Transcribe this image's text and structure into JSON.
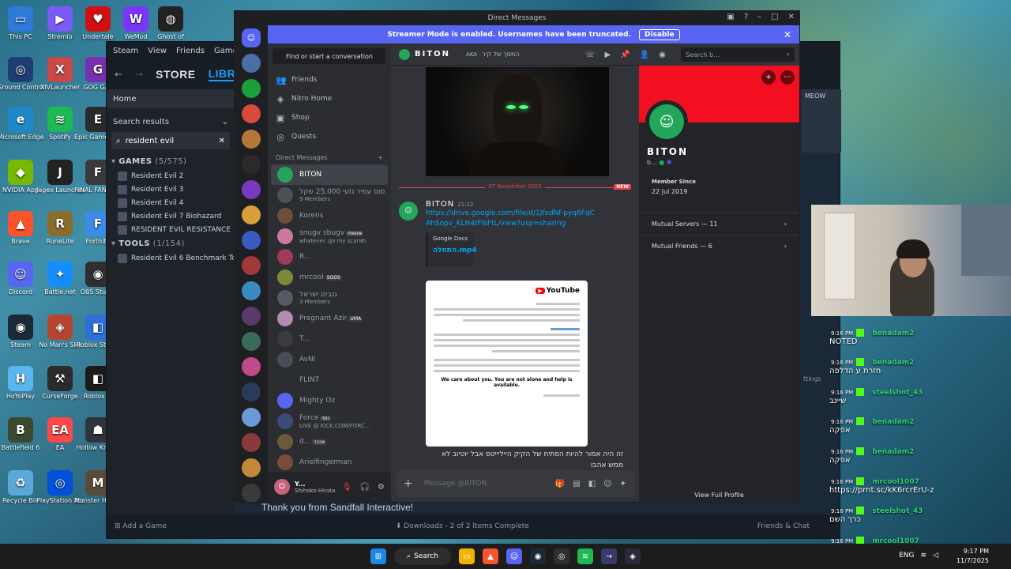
{
  "desktop": {
    "icons_col1": [
      {
        "label": "This PC",
        "color": "#2f7ad8",
        "glyph": "▭"
      },
      {
        "label": "Ground Control",
        "color": "#1e3d72",
        "glyph": "◎"
      },
      {
        "label": "Microsoft Edge",
        "color": "#1e88c8",
        "glyph": "e"
      },
      {
        "label": "NVIDIA App",
        "color": "#76b900",
        "glyph": "◆"
      },
      {
        "label": "Brave",
        "color": "#fb542b",
        "glyph": "▲"
      },
      {
        "label": "Discord",
        "color": "#5865f2",
        "glyph": "☺"
      },
      {
        "label": "Steam",
        "color": "#1b2838",
        "glyph": "◉"
      },
      {
        "label": "HoYoPlay",
        "color": "#5bb5f0",
        "glyph": "H"
      },
      {
        "label": "Battlefield 6",
        "color": "#3b4a2e",
        "glyph": "B"
      },
      {
        "label": "Recycle Bin",
        "color": "#5ca8d8",
        "glyph": "♻"
      }
    ],
    "icons_col2": [
      {
        "label": "Stremio",
        "color": "#7b5bf5",
        "glyph": "▶"
      },
      {
        "label": "XIVLauncher",
        "color": "#c94848",
        "glyph": "X"
      },
      {
        "label": "Spotify",
        "color": "#1db954",
        "glyph": "≋"
      },
      {
        "label": "Jagex Launcher",
        "color": "#222222",
        "glyph": "J"
      },
      {
        "label": "RuneLite",
        "color": "#8a6d2b",
        "glyph": "R"
      },
      {
        "label": "Battle.net",
        "color": "#148eff",
        "glyph": "✦"
      },
      {
        "label": "No Man's Sky",
        "color": "#b5452f",
        "glyph": "◈"
      },
      {
        "label": "CurseForge",
        "color": "#2b2b2b",
        "glyph": "⚒"
      },
      {
        "label": "EA",
        "color": "#ff4747",
        "glyph": "EA"
      },
      {
        "label": "PlayStation Accessories",
        "color": "#0050d8",
        "glyph": "◎"
      }
    ],
    "icons_col3": [
      {
        "label": "Undertale",
        "color": "#d01010",
        "glyph": "♥"
      },
      {
        "label": "GOG GAL",
        "color": "#7a2fb0",
        "glyph": "G"
      },
      {
        "label": "Epic Games Launcher",
        "color": "#2a2a2a",
        "glyph": "E"
      },
      {
        "label": "FINAL FANTASY",
        "color": "#3a3a3a",
        "glyph": "F"
      },
      {
        "label": "Fortnite",
        "color": "#3d8be8",
        "glyph": "F"
      },
      {
        "label": "OBS Studio",
        "color": "#302e31",
        "glyph": "◉"
      },
      {
        "label": "Roblox Studio",
        "color": "#2c6fd8",
        "glyph": "◧"
      },
      {
        "label": "Roblox Pl",
        "color": "#1b1b1b",
        "glyph": "◧"
      },
      {
        "label": "Hollow Knight",
        "color": "#30343a",
        "glyph": "☗"
      },
      {
        "label": "Monster Hunter W",
        "color": "#5a4a3a",
        "glyph": "M"
      }
    ],
    "icons_col4": [
      {
        "label": "WeMod",
        "color": "#7a35ff",
        "glyph": "W"
      },
      {
        "label": "Ghost of",
        "color": "#222222",
        "glyph": "◍"
      }
    ]
  },
  "steam": {
    "menu": [
      "Steam",
      "View",
      "Friends",
      "Games",
      "He"
    ],
    "nav_store": "STORE",
    "nav_library": "LIBRARY",
    "home": "Home",
    "search_results": "Search results",
    "search_value": "resident evil",
    "games_header": "GAMES",
    "games_count": "(5/575)",
    "games": [
      "Resident Evil 2",
      "Resident Evil 3",
      "Resident Evil 4",
      "Resident Evil 7 Biohazard",
      "RESIDENT EVIL RESISTANCE"
    ],
    "tools_header": "TOOLS",
    "tools_count": "(1/154)",
    "tools": [
      "Resident Evil 6 Benchmark Tool"
    ],
    "add_game": "Add a Game",
    "downloads": "Downloads - 2 of 2 Items Complete",
    "friends_chat": "Friends & Chat",
    "banner_text": "Thank you from Sandfall Interactive!",
    "meow": "MEOW",
    "settings_partial": "ttings"
  },
  "discord": {
    "window_title": "Direct Messages",
    "streamer_text": "Streamer Mode is enabled. Usernames have been truncated.",
    "streamer_btn": "Disable",
    "find_placeholder": "Find or start a conversation",
    "nav": [
      {
        "icon": "👥",
        "label": "Friends",
        "name": "friends"
      },
      {
        "icon": "◈",
        "label": "Nitro Home",
        "name": "nitro-home"
      },
      {
        "icon": "▣",
        "label": "Shop",
        "name": "shop"
      },
      {
        "icon": "◎",
        "label": "Quests",
        "name": "quests"
      }
    ],
    "dm_header": "Direct Messages",
    "dms": [
      {
        "name": "BITON",
        "sub": "",
        "color": "#23a55a",
        "active": true,
        "tag": ""
      },
      {
        "name": "סוס עמיר גזעי 25,000 שקל",
        "sub": "9 Members",
        "color": "#4e5058",
        "active": false,
        "tag": ""
      },
      {
        "name": "Korens",
        "sub": "",
        "color": "#6b4f3a",
        "active": false,
        "tag": ""
      },
      {
        "name": "snugv sbugv",
        "sub": "whatever. go my scarab",
        "color": "#c97aa0",
        "active": false,
        "tag": "meow"
      },
      {
        "name": "R...",
        "sub": "",
        "color": "#a03a5a",
        "active": false,
        "tag": ""
      },
      {
        "name": "mrcool",
        "sub": "",
        "color": "#7a8a3a",
        "active": false,
        "tag": "SOOS"
      },
      {
        "name": "גנבים ישראל",
        "sub": "3 Members",
        "color": "#555a64",
        "active": false,
        "tag": ""
      },
      {
        "name": "Pregnant Azir",
        "sub": "",
        "color": "#b58ab0",
        "active": false,
        "tag": "UMA"
      },
      {
        "name": "T...",
        "sub": "",
        "color": "#3a3c42",
        "active": false,
        "tag": ""
      },
      {
        "name": "AvNi",
        "sub": "",
        "color": "#4a4d55",
        "active": false,
        "tag": ""
      },
      {
        "name": "FLINT",
        "sub": "",
        "color": "#2a2d33",
        "active": false,
        "tag": ""
      },
      {
        "name": "Mighty Oz",
        "sub": "",
        "color": "#5865f2",
        "active": false,
        "tag": ""
      },
      {
        "name": "Force",
        "sub": "LIVE @ KICK.COM/FORC...",
        "color": "#3a4a7a",
        "active": false,
        "tag": "כוסי"
      },
      {
        "name": "d...",
        "sub": "",
        "color": "#6b5a3a",
        "active": false,
        "tag": "אכבר"
      },
      {
        "name": "Arielfingerman",
        "sub": "",
        "color": "#7a4a3a",
        "active": false,
        "tag": ""
      }
    ],
    "user": {
      "name": "Y...",
      "status": "Shihoko Hirata"
    },
    "chat_name": "BITON",
    "aka_label": "AKA",
    "aka_value": "המסך של קיר",
    "search_placeholder": "Search b...",
    "divider_date": "07 November 2025",
    "divider_new": "NEW",
    "msg_author": "BITON",
    "msg_time": "21:12",
    "msg_link": "https://drive.google.com/file/d/1JfxdNf-pyq6FqCAhSopv_KLH4tFlsFtL/view?usp=sharing",
    "embed_provider": "Google Docs",
    "embed_title": "התחלה.mp4",
    "yt_brand": "YouTube",
    "yt_english": "We care about you. You are not alone and help is available.",
    "msg_text": "זה היה אמור להיות הפתיח של הקיק הייליייטס אבל יוטיוב לא ממש אהבו",
    "composer_placeholder": "Message @BITON",
    "profile": {
      "name": "BITON",
      "sub": "b...",
      "member_since_label": "Member Since",
      "member_since": "22 Jul 2019",
      "mutual_servers": "Mutual Servers — 11",
      "mutual_friends": "Mutual Friends — 6",
      "view_full": "View Full Profile"
    },
    "servers": [
      "#4a6fa5",
      "#1a9f3a",
      "#d84a3a",
      "#b5763a",
      "#2a2a2a",
      "#7a3ac0",
      "#d8a03a",
      "#3a5ac0",
      "#a03a3a",
      "#3a8ac0",
      "#5a3a6a",
      "#3a6a5a",
      "#c04a8a",
      "#2a3a5a",
      "#6a9ad8",
      "#8a3a3a",
      "#c08a3a",
      "#3a3a3a"
    ]
  },
  "overlay": [
    {
      "time": "9:16 PM",
      "user": "benadam2",
      "msg": "NOTED"
    },
    {
      "time": "9:16 PM",
      "user": "benadam2",
      "msg": "חזרת ע הדלפה"
    },
    {
      "time": "9:16 PM",
      "user": "steelshot_43",
      "msg": "שיינב"
    },
    {
      "time": "9:16 PM",
      "user": "benadam2",
      "msg": "אפקה"
    },
    {
      "time": "9:16 PM",
      "user": "benadam2",
      "msg": "אפקה"
    },
    {
      "time": "9:16 PM",
      "user": "mrcool1007",
      "msg": "https://prnt.sc/kK6rcrErU-z"
    },
    {
      "time": "9:16 PM",
      "user": "steelshot_43",
      "msg": "כרך השם"
    },
    {
      "time": "9:16 PM",
      "user": "mrcool1007",
      "msg": "https://prnt.sc/kK6rcrErU-z"
    }
  ],
  "taskbar": {
    "search": "Search",
    "time": "9:17 PM",
    "date": "11/7/2025",
    "lang": "ENG"
  }
}
